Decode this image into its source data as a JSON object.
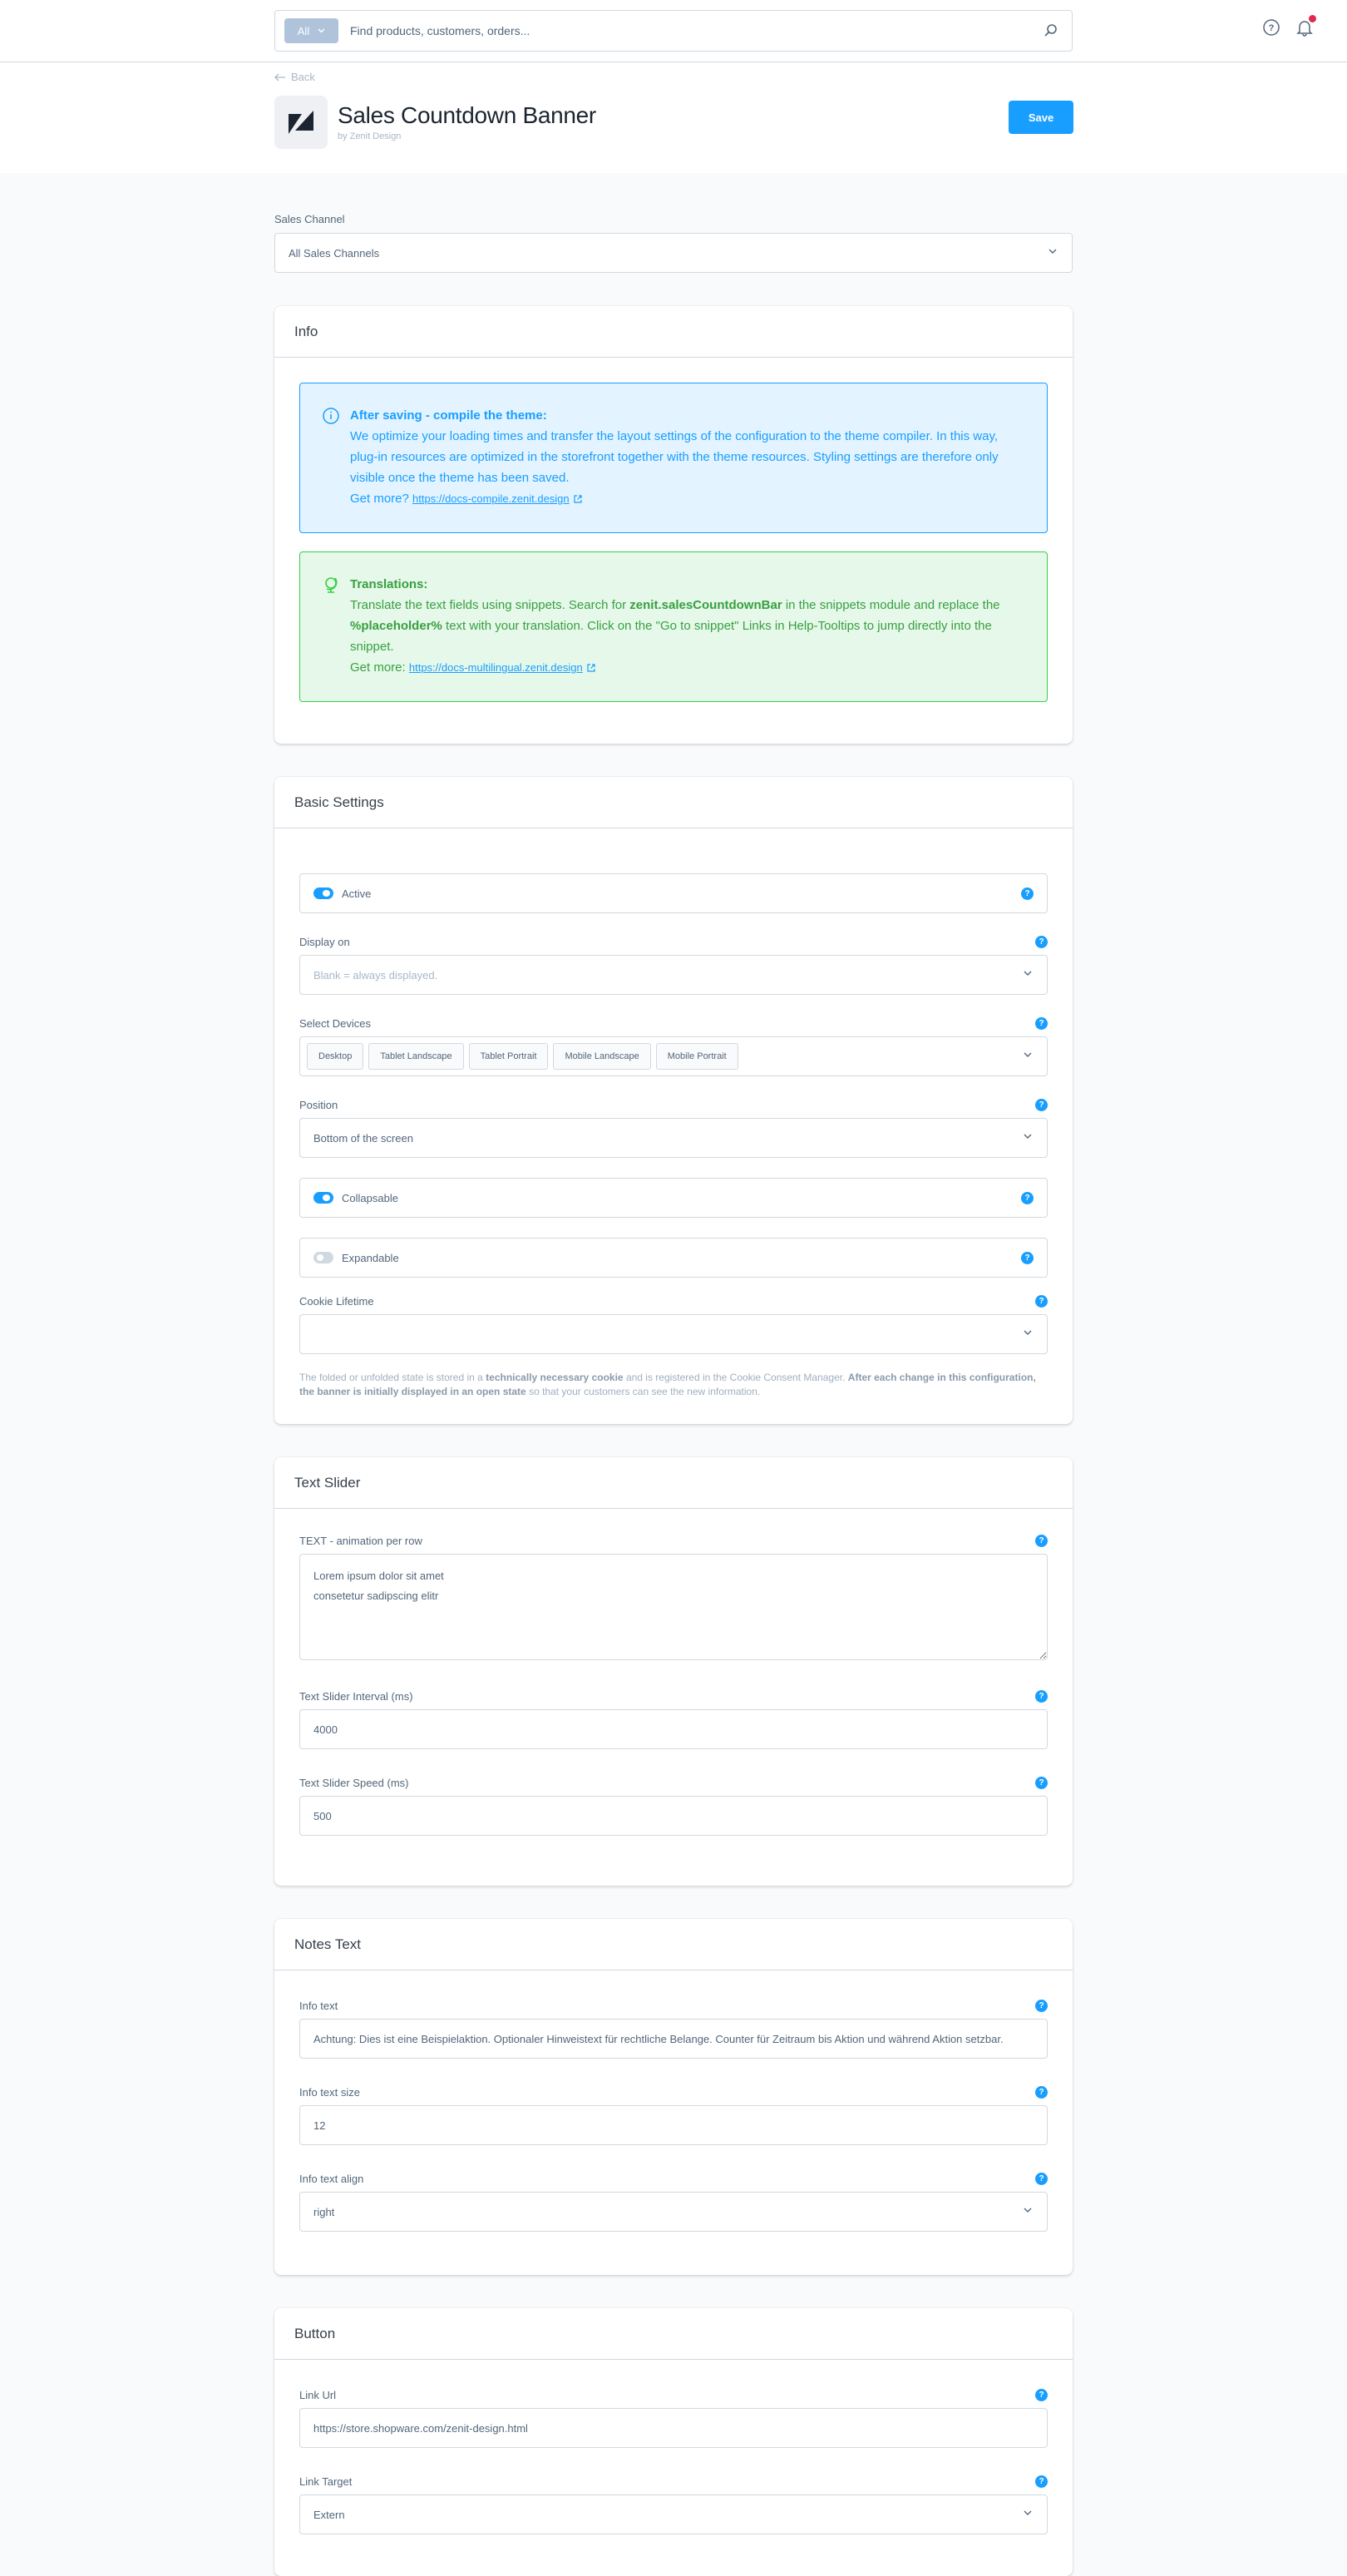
{
  "topbar": {
    "search_type": "All",
    "search_placeholder": "Find products, customers, orders...",
    "notification_dot_color": "#de294c"
  },
  "header": {
    "back_label": "Back",
    "title": "Sales Countdown Banner",
    "subtitle": "by Zenit Design",
    "save_label": "Save"
  },
  "sales_channel": {
    "label": "Sales Channel",
    "value": "All Sales Channels"
  },
  "info_card": {
    "title": "Info",
    "compile_alert": {
      "heading": "After saving - compile the theme:",
      "body": "We optimize your loading times and transfer the layout settings of the configuration to the theme compiler. In this way, plug-in resources are optimized in the storefront together with the theme resources. Styling settings are therefore only visible once the theme has been saved.",
      "more_label": "Get more?",
      "link": "https://docs-compile.zenit.design"
    },
    "translation_alert": {
      "heading": "Translations:",
      "body_1": "Translate the text fields using snippets. Search for",
      "body_key": "zenit.salesCountdownBar",
      "body_2": "in the snippets module and replace the",
      "body_placeholder": "%placeholder%",
      "body_3": "text with your translation. Click on the \"Go to snippet\" Links in Help-Tooltips to jump directly into the snippet.",
      "more_label": "Get more:",
      "link": "https://docs-multilingual.zenit.design"
    }
  },
  "basic_settings": {
    "title": "Basic Settings",
    "active": {
      "label": "Active",
      "checked": true
    },
    "display_on": {
      "label": "Display on",
      "placeholder": "Blank = always displayed."
    },
    "devices": {
      "label": "Select Devices",
      "selected": [
        "Desktop",
        "Tablet Landscape",
        "Tablet Portrait",
        "Mobile Landscape",
        "Mobile Portrait"
      ]
    },
    "position": {
      "label": "Position",
      "value": "Bottom of the screen"
    },
    "collapsable": {
      "label": "Collapsable",
      "checked": true
    },
    "expandable": {
      "label": "Expandable",
      "checked": false
    },
    "cookie_lifetime": {
      "label": "Cookie Lifetime",
      "value": ""
    },
    "note": {
      "part1": "The folded or unfolded state is stored in a",
      "bold1": "technically necessary cookie",
      "part2": "and is registered in the Cookie Consent Manager.",
      "bold2": "After each change in this configuration, the banner is initially displayed in an open state",
      "part3": "so that your customers can see the new information."
    }
  },
  "text_slider": {
    "title": "Text Slider",
    "text": {
      "label": "TEXT - animation per row",
      "value": "Lorem ipsum dolor sit amet\nconsetetur sadipscing elitr"
    },
    "interval": {
      "label": "Text Slider Interval (ms)",
      "value": "4000"
    },
    "speed": {
      "label": "Text Slider Speed (ms)",
      "value": "500"
    }
  },
  "notes_text": {
    "title": "Notes Text",
    "info_text": {
      "label": "Info text",
      "value": "Achtung: Dies ist eine Beispielaktion. Optionaler Hinweistext für rechtliche Belange. Counter für Zeitraum bis Aktion und während Aktion setzbar."
    },
    "info_text_size": {
      "label": "Info text size",
      "value": "12"
    },
    "info_text_align": {
      "label": "Info text align",
      "value": "right"
    }
  },
  "button": {
    "title": "Button",
    "link_url": {
      "label": "Link Url",
      "value": "https://store.shopware.com/zenit-design.html"
    },
    "link_target": {
      "label": "Link Target",
      "value": "Extern"
    }
  },
  "help_glyph": "?"
}
